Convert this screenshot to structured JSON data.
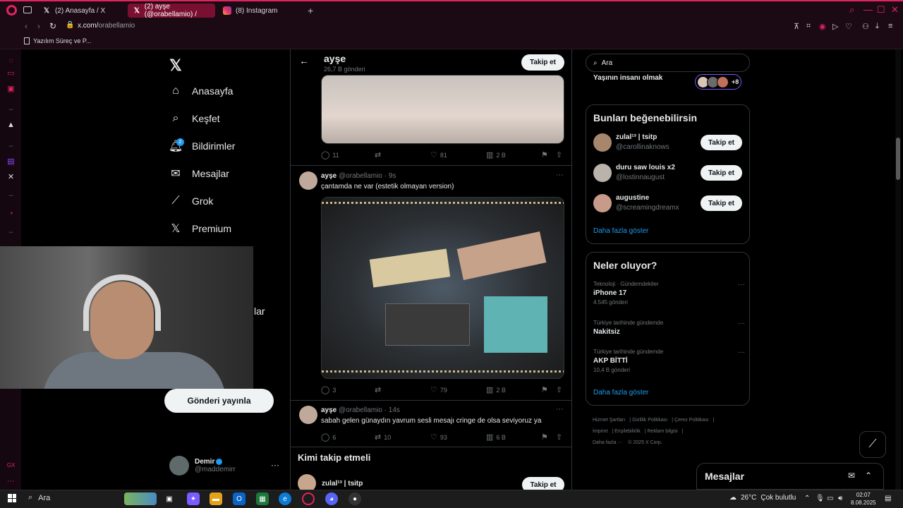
{
  "browser": {
    "tabs": [
      {
        "label": "(2) Anasayfa / X",
        "icon": "x-icon"
      },
      {
        "label": "(2) ayşe (@orabellamio) /",
        "icon": "x-icon"
      },
      {
        "label": "(8) Instagram",
        "icon": "instagram-icon"
      }
    ],
    "url_host": "x.com/",
    "url_path": "orabellamio",
    "bookmark": "Yazılım Süreç ve P..."
  },
  "nav": {
    "items": [
      {
        "label": "Anasayfa",
        "icon": "home-icon"
      },
      {
        "label": "Keşfet",
        "icon": "search-icon"
      },
      {
        "label": "Bildirimler",
        "icon": "bell-icon"
      },
      {
        "label": "Mesajlar",
        "icon": "mail-icon"
      },
      {
        "label": "Grok",
        "icon": "grok-icon"
      },
      {
        "label": "Premium",
        "icon": "x-icon"
      }
    ],
    "notif_count": "2",
    "partial_label": "lar",
    "post_button": "Gönderi yayınla",
    "account": {
      "name": "Demir",
      "handle": "@maddemirr"
    }
  },
  "profile_header": {
    "name": "ayşe",
    "posts_count": "26,7 B gönderi",
    "follow": "Takip et"
  },
  "post0_actions": {
    "replies": "11",
    "likes": "81",
    "views": "2 B"
  },
  "post1": {
    "name": "ayşe",
    "handle": "@orabellamio",
    "time": "· 9s",
    "text": "çantamda ne var (estetik olmayan version)",
    "replies": "3",
    "likes": "79",
    "views": "2 B"
  },
  "post2": {
    "name": "ayşe",
    "handle": "@orabellamio",
    "time": "· 14s",
    "text": "sabah gelen günaydın yavrum sesli mesajı cringe de olsa seviyoruz ya",
    "replies": "6",
    "reposts": "10",
    "likes": "93",
    "views": "6 B"
  },
  "who_to_follow": {
    "title": "Kimi takip etmeli",
    "first_name": "zulal¹³ | tsitp",
    "follow": "Takip et"
  },
  "right": {
    "search_placeholder": "Ara",
    "trend_top": "Yaşının insanı olmak",
    "avatars_more": "+8",
    "suggest_title": "Bunları beğenebilirsin",
    "suggestions": [
      {
        "name": "zulal¹³ | tsitp",
        "handle": "@carollinaknows",
        "follow": "Takip et"
      },
      {
        "name": "duru saw louis x2",
        "handle": "@lostinnaugust",
        "follow": "Takip et"
      },
      {
        "name": "augustine",
        "handle": "@screamingdreamx",
        "follow": "Takip et"
      }
    ],
    "show_more": "Daha fazla göster",
    "trends_title": "Neler oluyor?",
    "trends": [
      {
        "context": "Teknoloji · Gündemdekiler",
        "title": "iPhone 17",
        "count": "4.545 gönderi"
      },
      {
        "context": "Türkiye tarihinde gündemde",
        "title": "Nakitsiz",
        "count": ""
      },
      {
        "context": "Türkiye tarihinde gündemde",
        "title": "AKP BİTTİ",
        "count": "10,4 B gönderi"
      }
    ],
    "trends_more": "Daha fazla göster",
    "footer": [
      "Hizmet Şartları",
      "Gizlilik Politikası",
      "Çerez Politikası",
      "İmprint",
      "Erişilebilirlik",
      "Reklam bilgisi",
      "Daha fazla ···",
      "© 2025 X Corp."
    ],
    "messages_title": "Mesajlar"
  },
  "taskbar": {
    "search": "Ara",
    "weather_temp": "26°C",
    "weather_text": "Çok bulutlu",
    "time": "02:07",
    "date": "8.08.2025"
  }
}
